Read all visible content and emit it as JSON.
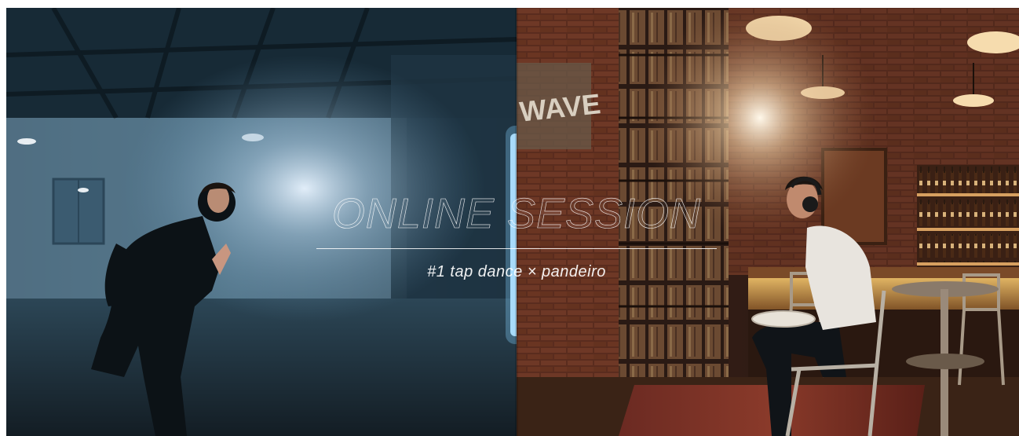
{
  "hero": {
    "title": "ONLINE SESSION",
    "subtitle": "#1 tap dance × pandeiro",
    "sign_text": "WAVE"
  },
  "colors": {
    "left_scene": "#23445a",
    "right_scene": "#3a2418",
    "warm_light": "#f3c27a",
    "title_text": "#ffffff"
  }
}
